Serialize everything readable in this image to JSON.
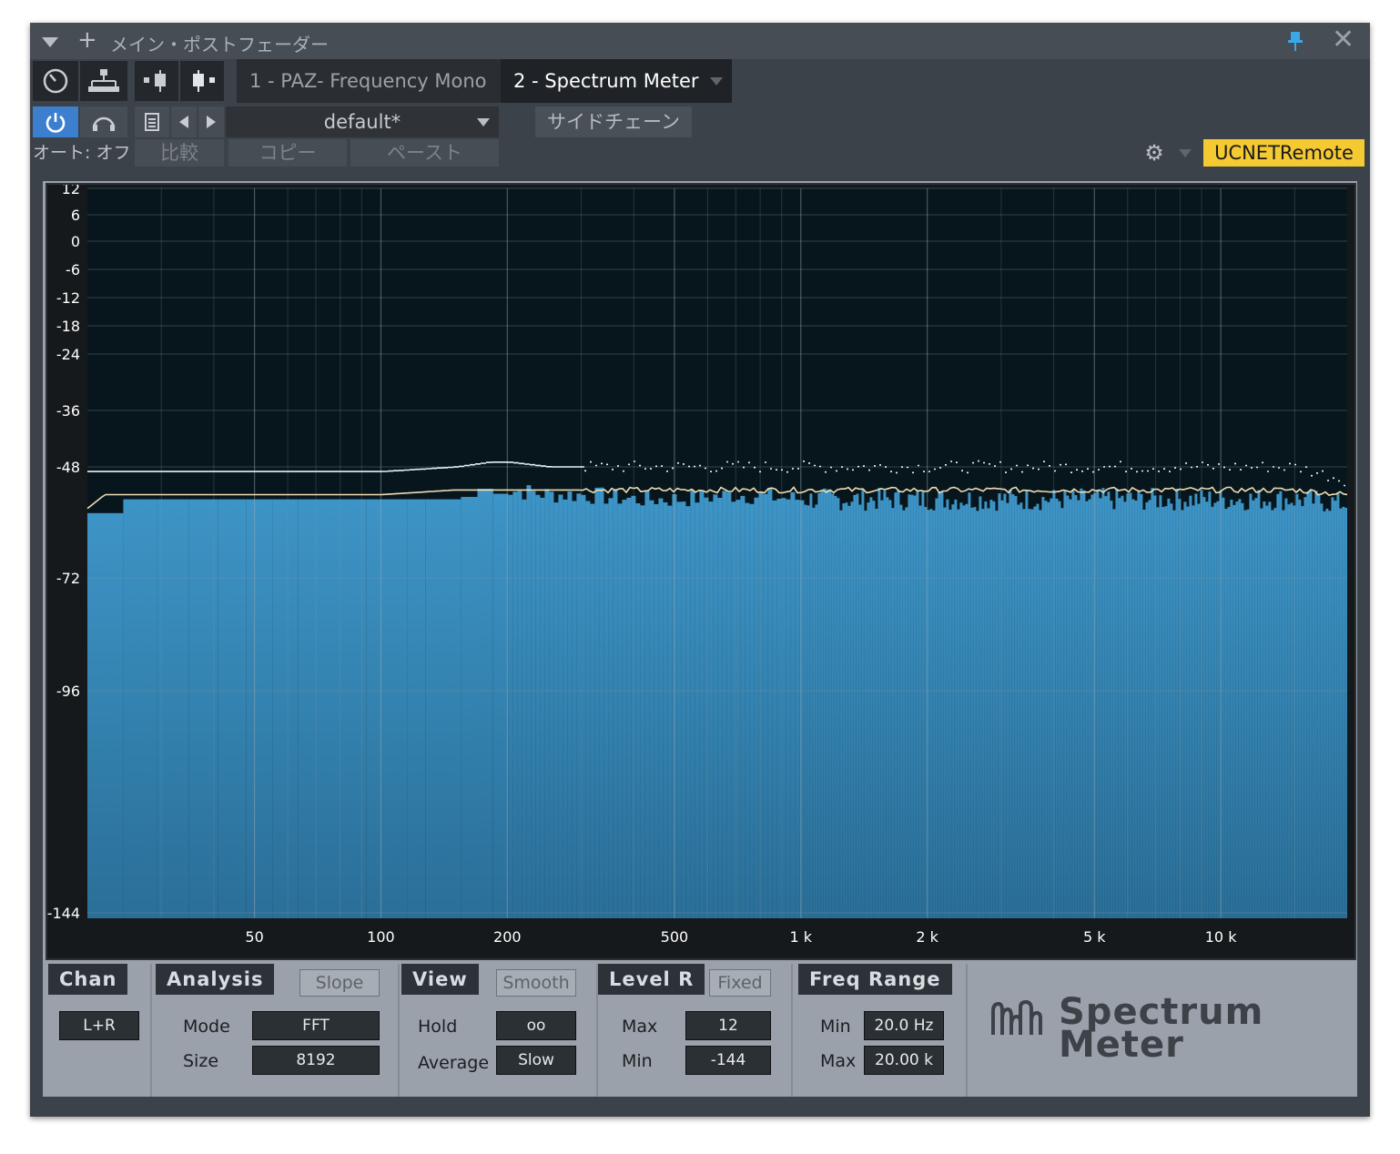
{
  "window": {
    "title": "メイン・ポストフェーダー"
  },
  "tabs": [
    {
      "label": "1 - PAZ- Frequency Mono"
    },
    {
      "label": "2 - Spectrum Meter"
    }
  ],
  "preset": {
    "name": "default*"
  },
  "sidechain": {
    "label": "サイドチェーン"
  },
  "auto": {
    "label": "オート: オフ"
  },
  "edit": {
    "compare": "比較",
    "copy": "コピー",
    "paste": "ペースト"
  },
  "remote": {
    "label": "UCNETRemote",
    "color": "#f4c932"
  },
  "icons": [
    "dropdown-triangle-icon",
    "add-icon",
    "pin-icon",
    "close-icon",
    "meter-dial-icon",
    "routing-icon",
    "insert-left-icon",
    "insert-right-icon",
    "power-icon",
    "headphones-icon",
    "document-icon",
    "prev-arrow-icon",
    "next-arrow-icon",
    "gear-icon"
  ],
  "chart_data": {
    "type": "area",
    "title": "",
    "xlabel": "",
    "ylabel": "",
    "x_scale": "log",
    "xlim": [
      20,
      20000
    ],
    "ylim": [
      -144,
      12
    ],
    "y_ticks": [
      12,
      6,
      0,
      -6,
      -12,
      -18,
      -24,
      -36,
      -48,
      -72,
      -96,
      -144
    ],
    "x_ticks": [
      {
        "value": 50,
        "label": "50"
      },
      {
        "value": 100,
        "label": "100"
      },
      {
        "value": 200,
        "label": "200"
      },
      {
        "value": 500,
        "label": "500"
      },
      {
        "value": 1000,
        "label": "1 k"
      },
      {
        "value": 2000,
        "label": "2 k"
      },
      {
        "value": 5000,
        "label": "5 k"
      },
      {
        "value": 10000,
        "label": "10 k"
      }
    ],
    "grid": true,
    "fill_color": "#3a8fbf",
    "series": [
      {
        "x": [
          20,
          22,
          30,
          40,
          50,
          60,
          80,
          100,
          150,
          180,
          200,
          250,
          300,
          400,
          500,
          700,
          1000,
          1500,
          2000,
          3000,
          5000,
          7000,
          10000,
          15000,
          20000
        ],
        "values": [
          -58,
          -55,
          -55,
          -55,
          -55,
          -55,
          -55,
          -55,
          -55,
          -52,
          -53,
          -54,
          -54,
          -55,
          -55,
          -54,
          -55,
          -55,
          -55,
          -55,
          -55,
          -55,
          -55,
          -55,
          -56
        ]
      },
      {
        "x": [
          20,
          22,
          30,
          40,
          50,
          60,
          80,
          100,
          150,
          180,
          200,
          250,
          300,
          400,
          500,
          700,
          1000,
          1500,
          2000,
          3000,
          5000,
          7000,
          10000,
          15000,
          20000
        ],
        "values": [
          -49,
          -49,
          -49,
          -49,
          -49,
          -49,
          -49,
          -49,
          -48,
          -47,
          -47,
          -48,
          -48,
          -48,
          -48,
          -48,
          -48,
          -48,
          -48,
          -48,
          -48,
          -48,
          -48,
          -48,
          -51
        ]
      },
      {
        "x": [
          20,
          22,
          30,
          40,
          50,
          60,
          80,
          100,
          150,
          180,
          200,
          250,
          300,
          400,
          500,
          700,
          1000,
          1500,
          2000,
          3000,
          5000,
          7000,
          10000,
          15000,
          20000
        ],
        "values": [
          -57,
          -54,
          -54,
          -54,
          -54,
          -54,
          -54,
          -54,
          -53,
          -53,
          -53,
          -53,
          -53,
          -53,
          -53,
          -53,
          -53,
          -53,
          -53,
          -53,
          -53,
          -53,
          -53,
          -53,
          -54
        ]
      }
    ]
  },
  "controls": {
    "chan": {
      "header": "Chan",
      "value": "L+R"
    },
    "analysis": {
      "header": "Analysis",
      "slope": "Slope",
      "mode_label": "Mode",
      "mode_value": "FFT",
      "size_label": "Size",
      "size_value": "8192"
    },
    "view": {
      "header": "View",
      "smooth": "Smooth",
      "hold_label": "Hold",
      "hold_value": "oo",
      "average_label": "Average",
      "average_value": "Slow"
    },
    "level": {
      "header": "Level R",
      "fixed": "Fixed",
      "max_label": "Max",
      "max_value": "12",
      "min_label": "Min",
      "min_value": "-144"
    },
    "freq": {
      "header": "Freq Range",
      "min_label": "Min",
      "min_value": "20.0 Hz",
      "max_label": "Max",
      "max_value": "20.00 k"
    }
  },
  "brand": {
    "line1": "Spectrum",
    "line2": "Meter"
  }
}
